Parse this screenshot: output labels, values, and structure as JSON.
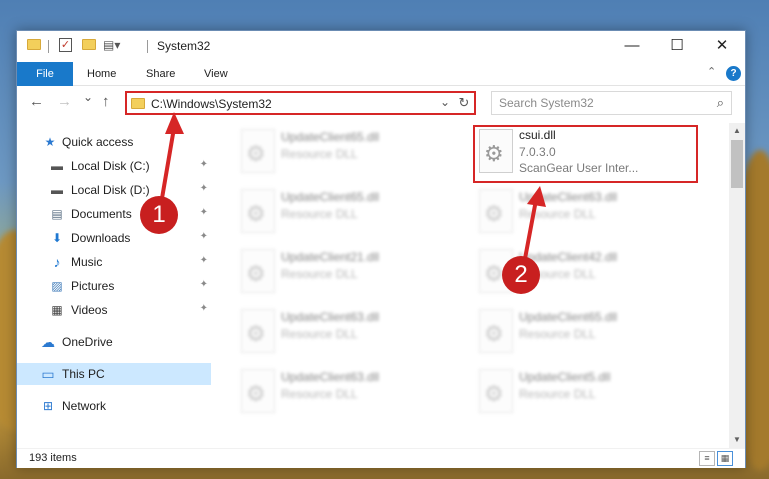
{
  "window": {
    "title": "System32",
    "caption": {
      "minimize": "—",
      "maximize": "☐",
      "close": "✕"
    }
  },
  "ribbon": {
    "tabs": [
      "File",
      "Home",
      "Share",
      "View"
    ],
    "collapse_glyph": "⌃",
    "help_glyph": "?"
  },
  "nav": {
    "back": "←",
    "forward": "→",
    "recent": "⌄",
    "up": "↑",
    "address": "C:\\Windows\\System32",
    "address_dropdown": "⌄",
    "refresh": "↻",
    "search_placeholder": "Search System32",
    "search_glyph": "⌕"
  },
  "sidebar": {
    "items": [
      {
        "label": "Quick access",
        "icon": "star-icon",
        "glyph": "★",
        "color": "#2b79d0",
        "pinned": false
      },
      {
        "label": "Local Disk (C:)",
        "icon": "drive-icon",
        "glyph": "▬",
        "color": "#555555",
        "pinned": true
      },
      {
        "label": "Local Disk (D:)",
        "icon": "drive-icon",
        "glyph": "▬",
        "color": "#555555",
        "pinned": true
      },
      {
        "label": "Documents",
        "icon": "documents-icon",
        "glyph": "▤",
        "color": "#5b6f84",
        "pinned": true
      },
      {
        "label": "Downloads",
        "icon": "download-icon",
        "glyph": "⬇",
        "color": "#1f78d1",
        "pinned": true
      },
      {
        "label": "Music",
        "icon": "music-icon",
        "glyph": "♪",
        "color": "#1f78d1",
        "pinned": true
      },
      {
        "label": "Pictures",
        "icon": "pictures-icon",
        "glyph": "▨",
        "color": "#3d7ab8",
        "pinned": true
      },
      {
        "label": "Videos",
        "icon": "videos-icon",
        "glyph": "▦",
        "color": "#444444",
        "pinned": true
      },
      {
        "label": "OneDrive",
        "icon": "cloud-icon",
        "glyph": "☁",
        "color": "#2b79d0",
        "pinned": false
      },
      {
        "label": "This PC",
        "icon": "computer-icon",
        "glyph": "▭",
        "color": "#2b79d0",
        "pinned": false,
        "selected": true
      },
      {
        "label": "Network",
        "icon": "network-icon",
        "glyph": "⊞",
        "color": "#2b79d0",
        "pinned": false
      }
    ],
    "pin_glyph": "✦"
  },
  "files": {
    "left_column": [
      {
        "name": "UpdateClient65.dll",
        "type": "Resource DLL"
      },
      {
        "name": "UpdateClient65.dll",
        "type": "Resource DLL"
      },
      {
        "name": "UpdateClient21.dll",
        "type": "Resource DLL"
      },
      {
        "name": "UpdateClient63.dll",
        "type": "Resource DLL"
      },
      {
        "name": "UpdateClient63.dll",
        "type": "Resource DLL"
      }
    ],
    "right_column": [
      {
        "name": "csui.dll",
        "version": "7.0.3.0",
        "description": "ScanGear User Inter..."
      },
      {
        "name": "UpdateClient63.dll",
        "type": "Resource DLL"
      },
      {
        "name": "UpdateClient42.dll",
        "type": "Resource DLL"
      },
      {
        "name": "UpdateClient65.dll",
        "type": "Resource DLL"
      },
      {
        "name": "UpdateClient5.dll",
        "type": "Resource DLL"
      }
    ],
    "gear_glyph": "⚙"
  },
  "status": {
    "item_count": "193 items",
    "details_view_glyph": "≡",
    "tiles_view_glyph": "▦"
  },
  "annotations": {
    "step1": "1",
    "step2": "2",
    "color": "#d62626"
  },
  "scroll": {
    "up": "▲",
    "down": "▼"
  }
}
